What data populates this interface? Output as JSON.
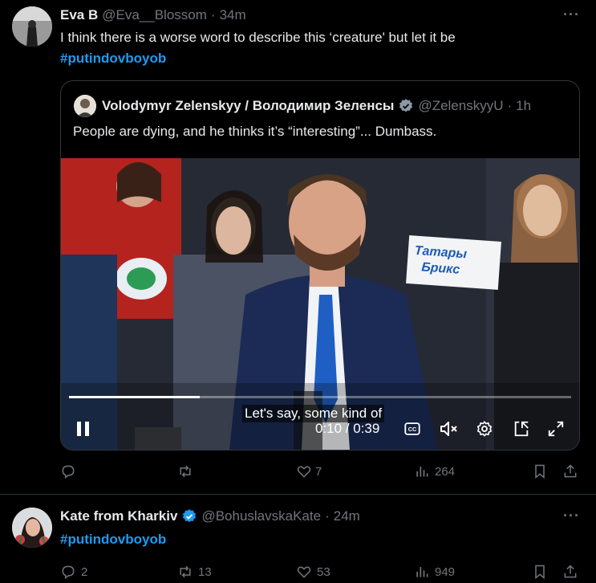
{
  "tweet1": {
    "display_name": "Eva B",
    "handle": "@Eva__Blossom",
    "dot": "·",
    "time": "34m",
    "text": "I think there is a worse word to describe this ‘creature' but let it be",
    "hashtag": "#putindovboyob",
    "quote": {
      "display_name": "Volodymyr Zelenskyy / Володимир Зеленсы",
      "handle": "@ZelenskyyU",
      "dot": "·",
      "time": "1h",
      "text": "People are dying, and he thinks it’s “interesting”... Dumbass.",
      "video": {
        "subtitle": "Let's say, some kind of",
        "time_display": "0:10 / 0:39",
        "progress": 0.26,
        "sign_text_line1": "Татары",
        "sign_text_line2": "Брикс"
      }
    },
    "actions": {
      "replies": "",
      "retweets": "",
      "likes": "7",
      "views": "264"
    }
  },
  "tweet2": {
    "display_name": "Kate from Kharkiv",
    "handle": "@BohuslavskaKate",
    "dot": "·",
    "time": "24m",
    "hashtag": "#putindovboyob",
    "actions": {
      "replies": "2",
      "retweets": "13",
      "likes": "53",
      "views": "949"
    }
  },
  "colors": {
    "background": "#000000",
    "text": "#e7e9ea",
    "muted": "#71767b",
    "accent": "#1d9bf0",
    "verified": "#1d9bf0"
  }
}
